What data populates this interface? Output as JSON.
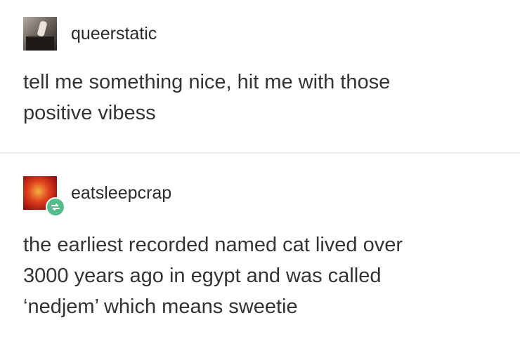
{
  "posts": [
    {
      "username": "queerstatic",
      "lines": [
        "tell me something nice, hit me with those",
        "positive vibess"
      ]
    },
    {
      "username": "eatsleepcrap",
      "lines": [
        "the earliest recorded named cat lived over",
        "3000 years ago in egypt and was called",
        "‘nedjem’ which means sweetie"
      ],
      "badge_icon": "reblog-icon",
      "badge_color": "#56bc8a"
    }
  ]
}
